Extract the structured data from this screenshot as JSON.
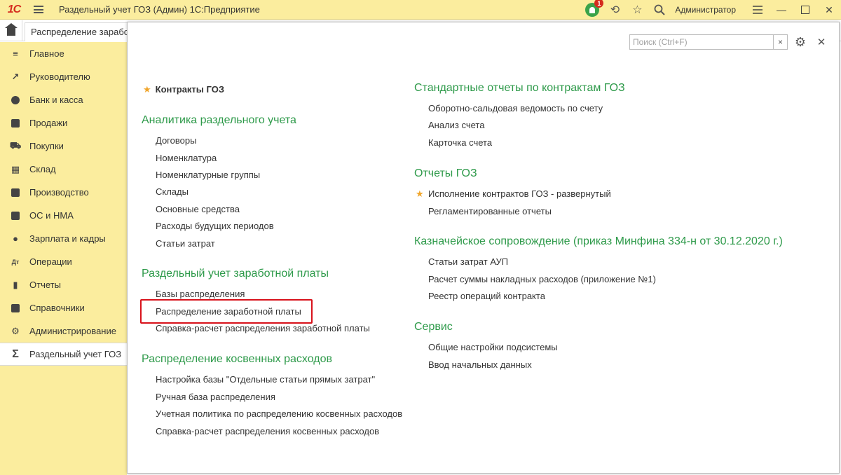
{
  "app": {
    "logo_text": "1С",
    "title": "Раздельный учет ГОЗ (Админ) 1С:Предприятие",
    "user": "Администратор",
    "notification_count": "1"
  },
  "tabs": {
    "active_doc": "Распределение заработной платы"
  },
  "sidebar": {
    "items": [
      {
        "label": "Главное",
        "icon": "menu-lines-icon"
      },
      {
        "label": "Руководителю",
        "icon": "chart-line-icon"
      },
      {
        "label": "Банк и касса",
        "icon": "ruble-coin-icon"
      },
      {
        "label": "Продажи",
        "icon": "shopping-bag-icon"
      },
      {
        "label": "Покупки",
        "icon": "cart-icon"
      },
      {
        "label": "Склад",
        "icon": "grid-icon"
      },
      {
        "label": "Производство",
        "icon": "factory-icon"
      },
      {
        "label": "ОС и НМА",
        "icon": "truck-icon"
      },
      {
        "label": "Зарплата и кадры",
        "icon": "person-icon"
      },
      {
        "label": "Операции",
        "icon": "dt-kt-icon"
      },
      {
        "label": "Отчеты",
        "icon": "bar-chart-icon"
      },
      {
        "label": "Справочники",
        "icon": "book-icon"
      },
      {
        "label": "Администрирование",
        "icon": "gear-icon"
      },
      {
        "label": "Раздельный учет ГОЗ",
        "icon": "sigma-icon"
      }
    ]
  },
  "search": {
    "placeholder": "Поиск (Ctrl+F)"
  },
  "left": {
    "favorite": "Контракты ГОЗ",
    "sections": [
      {
        "title": "Аналитика раздельного учета",
        "links": [
          "Договоры",
          "Номенклатура",
          "Номенклатурные группы",
          "Склады",
          "Основные средства",
          "Расходы будущих периодов",
          "Статьи затрат"
        ]
      },
      {
        "title": "Раздельный учет заработной платы",
        "links": [
          "Базы распределения",
          "Распределение заработной платы",
          "Справка-расчет распределения заработной платы"
        ]
      },
      {
        "title": "Распределение косвенных расходов",
        "links": [
          "Настройка базы \"Отдельные статьи прямых затрат\"",
          "Ручная база распределения",
          "Учетная политика по распределению косвенных расходов",
          "Справка-расчет распределения косвенных расходов"
        ]
      }
    ]
  },
  "right": {
    "sections": [
      {
        "title": "Стандартные отчеты по контрактам ГОЗ",
        "links": [
          "Оборотно-сальдовая ведомость по счету",
          "Анализ счета",
          "Карточка счета"
        ]
      },
      {
        "title": "Отчеты ГОЗ",
        "links": [
          "Исполнение контрактов ГОЗ - развернутый",
          "Регламентированные отчеты"
        ]
      },
      {
        "title": "Казначейское сопровождение (приказ Минфина 334-н от 30.12.2020 г.)",
        "links": [
          "Статьи затрат АУП",
          "Расчет суммы накладных расходов (приложение №1)",
          "Реестр операций контракта"
        ]
      },
      {
        "title": "Сервис",
        "links": [
          "Общие настройки подсистемы",
          "Ввод начальных данных"
        ]
      }
    ]
  }
}
